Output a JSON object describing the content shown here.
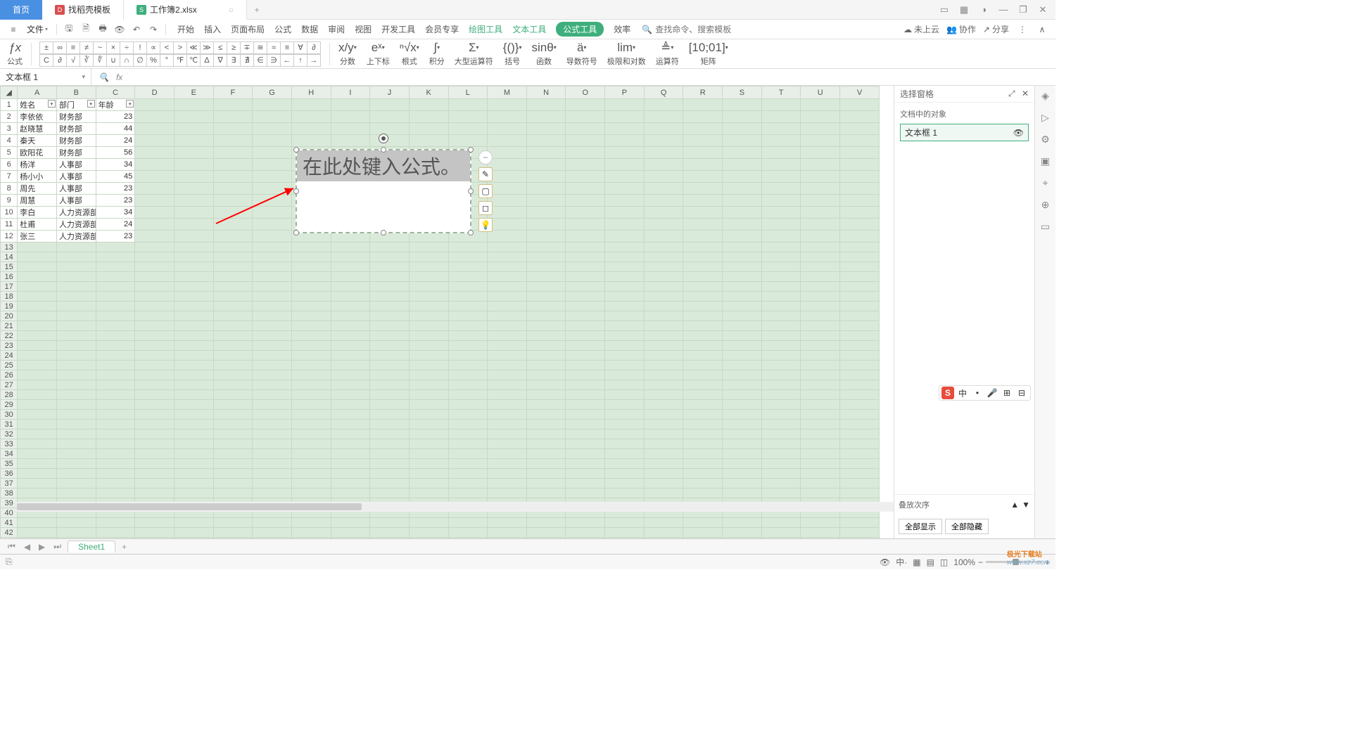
{
  "tabs": {
    "home": "首页",
    "template": "找稻壳模板",
    "file": "工作簿2.xlsx"
  },
  "menubar": {
    "file": "文件",
    "items": [
      "开始",
      "插入",
      "页面布局",
      "公式",
      "数据",
      "审阅",
      "视图",
      "开发工具",
      "会员专享"
    ],
    "context": [
      "绘图工具",
      "文本工具"
    ],
    "active": "公式工具",
    "effect": "效率",
    "search_placeholder": "查找命令、搜索模板",
    "cloud": "未上云",
    "collab": "协作",
    "share": "分享"
  },
  "ribbon": {
    "formula_label": "公式",
    "sym_rows": [
      [
        "±",
        "∞",
        "≡",
        "≠",
        "~",
        "×",
        "÷",
        "!",
        "∝",
        "<",
        ">",
        "≪",
        "≫",
        "≤",
        "≥",
        "∓",
        "≅",
        "≈",
        "≡",
        "∀",
        "∂"
      ],
      [
        "C",
        "∂",
        "√",
        "∛",
        "∜",
        "∪",
        "∩",
        "∅",
        "%",
        "°",
        "℉",
        "℃",
        "∆",
        "∇",
        "∃",
        "∄",
        "∈",
        "∋",
        "←",
        "↑",
        "→"
      ]
    ],
    "groups": [
      {
        "label": "分数",
        "icon": "x/y"
      },
      {
        "label": "上下标",
        "icon": "eˣ"
      },
      {
        "label": "根式",
        "icon": "ⁿ√x"
      },
      {
        "label": "积分",
        "icon": "∫"
      },
      {
        "label": "大型运算符",
        "icon": "Σ"
      },
      {
        "label": "括号",
        "icon": "{()}"
      },
      {
        "label": "函数",
        "icon": "sinθ"
      },
      {
        "label": "导数符号",
        "icon": "ä"
      },
      {
        "label": "极限和对数",
        "icon": "lim"
      },
      {
        "label": "运算符",
        "icon": "≜"
      },
      {
        "label": "矩阵",
        "icon": "[10;01]"
      }
    ]
  },
  "namebox": "文本框 1",
  "columns": [
    "A",
    "B",
    "C",
    "D",
    "E",
    "F",
    "G",
    "H",
    "I",
    "J",
    "K",
    "L",
    "M",
    "N",
    "O",
    "P",
    "Q",
    "R",
    "S",
    "T",
    "U",
    "V"
  ],
  "headers": [
    "姓名",
    "部门",
    "年龄"
  ],
  "rows": [
    {
      "n": "李依依",
      "d": "财务部",
      "a": "23"
    },
    {
      "n": "赵晓慧",
      "d": "财务部",
      "a": "44"
    },
    {
      "n": "秦天",
      "d": "财务部",
      "a": "24"
    },
    {
      "n": "欧阳花",
      "d": "财务部",
      "a": "56"
    },
    {
      "n": "杨洋",
      "d": "人事部",
      "a": "34"
    },
    {
      "n": "杨小小",
      "d": "人事部",
      "a": "45"
    },
    {
      "n": "周先",
      "d": "人事部",
      "a": "23"
    },
    {
      "n": "周慧",
      "d": "人事部",
      "a": "23"
    },
    {
      "n": "李白",
      "d": "人力资源部",
      "a": "34"
    },
    {
      "n": "杜甫",
      "d": "人力资源部",
      "a": "24"
    },
    {
      "n": "张三",
      "d": "人力资源部",
      "a": "23"
    }
  ],
  "formula_placeholder": "在此处键入公式。",
  "taskpane": {
    "title": "选择窗格",
    "section": "文档中的对象",
    "item": "文本框 1",
    "order": "叠放次序",
    "showall": "全部显示",
    "hideall": "全部隐藏"
  },
  "sheet_tab": "Sheet1",
  "status": {
    "zoom": "100%"
  },
  "ime": [
    "中",
    "•",
    "🎤",
    "⊞",
    "⊟"
  ],
  "watermark": {
    "brand": "极光下载站",
    "url": "www.xz7.com"
  }
}
